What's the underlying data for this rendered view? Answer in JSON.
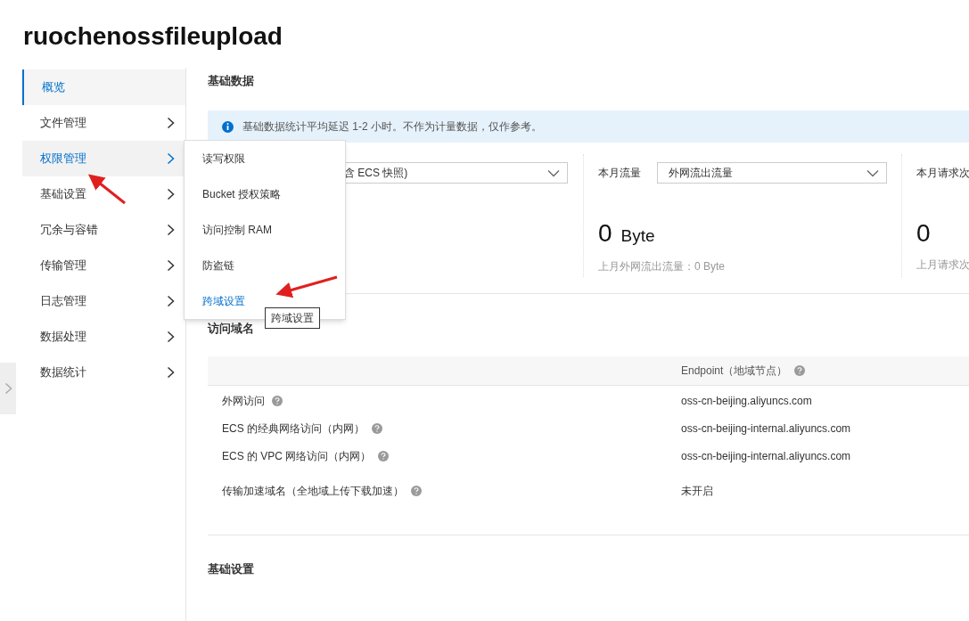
{
  "title": "ruochenossfileupload",
  "sidebar": {
    "items": [
      {
        "label": "概览",
        "selected": true,
        "expanded": false,
        "has_arrow": false
      },
      {
        "label": "文件管理",
        "selected": false,
        "expanded": false,
        "has_arrow": true
      },
      {
        "label": "权限管理",
        "selected": false,
        "expanded": true,
        "has_arrow": true
      },
      {
        "label": "基础设置",
        "selected": false,
        "expanded": false,
        "has_arrow": true
      },
      {
        "label": "冗余与容错",
        "selected": false,
        "expanded": false,
        "has_arrow": true
      },
      {
        "label": "传输管理",
        "selected": false,
        "expanded": false,
        "has_arrow": true
      },
      {
        "label": "日志管理",
        "selected": false,
        "expanded": false,
        "has_arrow": true
      },
      {
        "label": "数据处理",
        "selected": false,
        "expanded": false,
        "has_arrow": true
      },
      {
        "label": "数据统计",
        "selected": false,
        "expanded": false,
        "has_arrow": true
      }
    ]
  },
  "submenu": {
    "items": [
      {
        "label": "读写权限",
        "selected": false
      },
      {
        "label": "Bucket 授权策略",
        "selected": false
      },
      {
        "label": "访问控制 RAM",
        "selected": false
      },
      {
        "label": "防盗链",
        "selected": false
      },
      {
        "label": "跨域设置",
        "selected": true
      }
    ],
    "tooltip": "跨域设置"
  },
  "basic_data": {
    "heading": "基础数据",
    "notice": "基础数据统计平均延迟 1-2 小时。不作为计量数据，仅作参考。",
    "stats": [
      {
        "select": "含 ECS 快照)"
      },
      {
        "label": "本月流量",
        "select": "外网流出流量",
        "value": "0",
        "unit": "Byte",
        "previous": "上月外网流出流量：0 Byte"
      },
      {
        "label": "本月请求次",
        "value": "0",
        "previous": "上月请求次"
      }
    ]
  },
  "domains": {
    "heading": "访问域名",
    "columns": {
      "column_2": "Endpoint（地域节点）"
    },
    "rows": [
      {
        "name": "外网访问",
        "value": "oss-cn-beijing.aliyuncs.com"
      },
      {
        "name": "ECS 的经典网络访问（内网）",
        "value": "oss-cn-beijing-internal.aliyuncs.com"
      },
      {
        "name": "ECS 的 VPC 网络访问（内网）",
        "value": "oss-cn-beijing-internal.aliyuncs.com"
      },
      {
        "name": "传输加速域名（全地域上传下载加速）",
        "value": "未开启"
      }
    ]
  },
  "settings": {
    "heading": "基础设置"
  }
}
